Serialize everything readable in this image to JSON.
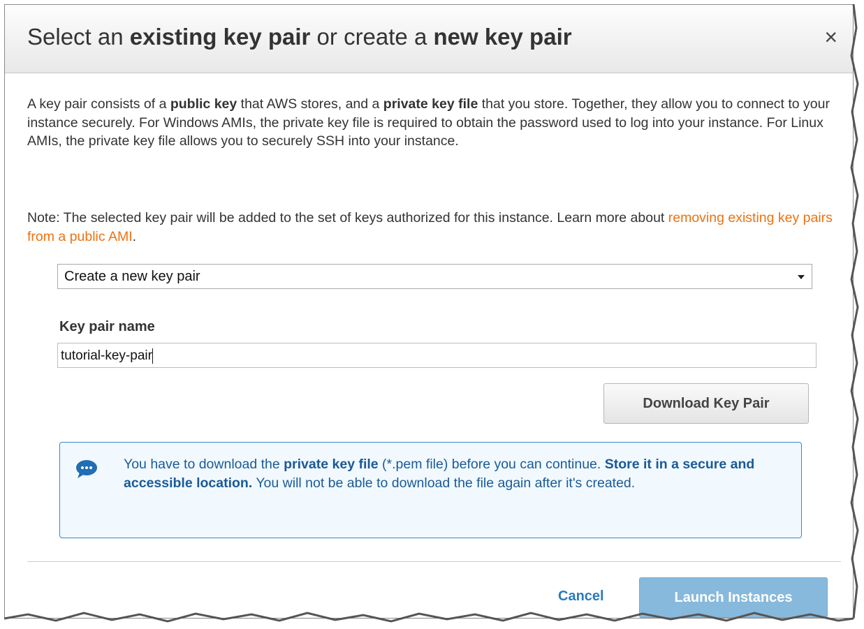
{
  "dialog": {
    "title": {
      "part1": "Select an ",
      "part2": "existing key pair",
      "part3": " or create a ",
      "part4": "new key pair"
    },
    "close_symbol": "×"
  },
  "description": {
    "t1": "A key pair consists of a ",
    "b1": "public key",
    "t2": " that AWS stores, and a ",
    "b2": "private key file",
    "t3": " that you store. Together, they allow you to connect to your instance securely. For Windows AMIs, the private key file is required to obtain the password used to log into your instance. For Linux AMIs, the private key file allows you to securely SSH into your instance."
  },
  "note": {
    "text": "Note: The selected key pair will be added to the set of keys authorized for this instance. Learn more about ",
    "link": "removing existing key pairs from a public AMI",
    "end": "."
  },
  "key_pair_select": {
    "selected": "Create a new key pair"
  },
  "key_pair_name": {
    "label": "Key pair name",
    "value": "tutorial-key-pair"
  },
  "download_button": "Download Key Pair",
  "info": {
    "t1": "You have to download the ",
    "b1": "private key file",
    "t2": " (*.pem file) before you can continue. ",
    "b2": "Store it in a secure and accessible location.",
    "t3": " You will not be able to download the file again after it's created."
  },
  "footer": {
    "cancel": "Cancel",
    "launch": "Launch Instances"
  },
  "colors": {
    "link": "#ec7211",
    "info_text": "#1b5a96",
    "info_border": "#3a87c7",
    "info_bg": "#f1f9ff",
    "primary_disabled": "#87b9dc",
    "cancel": "#2b7bb9"
  },
  "icons": {
    "info": "speech-bubble-icon",
    "close": "close-icon",
    "dropdown": "chevron-down-icon"
  }
}
